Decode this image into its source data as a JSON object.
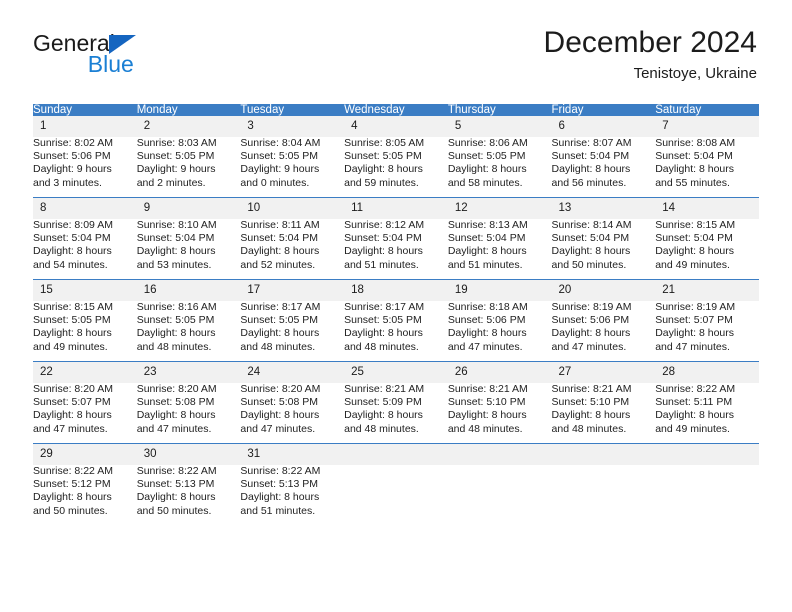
{
  "brand": {
    "name_top": "General",
    "name_bottom": "Blue",
    "triangle_color": "#1565c0",
    "blue_text_color": "#1a7fd4"
  },
  "header": {
    "title": "December 2024",
    "subtitle": "Tenistoye, Ukraine"
  },
  "theme": {
    "header_row_bg": "#3b7dc4",
    "header_row_text": "#ffffff",
    "daynum_bg": "#f1f1f1",
    "row_divider": "#3b7dc4"
  },
  "calendar": {
    "weekday_headers": [
      "Sunday",
      "Monday",
      "Tuesday",
      "Wednesday",
      "Thursday",
      "Friday",
      "Saturday"
    ],
    "weeks": [
      [
        {
          "day": "1",
          "sunrise": "Sunrise: 8:02 AM",
          "sunset": "Sunset: 5:06 PM",
          "daylight_1": "Daylight: 9 hours",
          "daylight_2": "and 3 minutes."
        },
        {
          "day": "2",
          "sunrise": "Sunrise: 8:03 AM",
          "sunset": "Sunset: 5:05 PM",
          "daylight_1": "Daylight: 9 hours",
          "daylight_2": "and 2 minutes."
        },
        {
          "day": "3",
          "sunrise": "Sunrise: 8:04 AM",
          "sunset": "Sunset: 5:05 PM",
          "daylight_1": "Daylight: 9 hours",
          "daylight_2": "and 0 minutes."
        },
        {
          "day": "4",
          "sunrise": "Sunrise: 8:05 AM",
          "sunset": "Sunset: 5:05 PM",
          "daylight_1": "Daylight: 8 hours",
          "daylight_2": "and 59 minutes."
        },
        {
          "day": "5",
          "sunrise": "Sunrise: 8:06 AM",
          "sunset": "Sunset: 5:05 PM",
          "daylight_1": "Daylight: 8 hours",
          "daylight_2": "and 58 minutes."
        },
        {
          "day": "6",
          "sunrise": "Sunrise: 8:07 AM",
          "sunset": "Sunset: 5:04 PM",
          "daylight_1": "Daylight: 8 hours",
          "daylight_2": "and 56 minutes."
        },
        {
          "day": "7",
          "sunrise": "Sunrise: 8:08 AM",
          "sunset": "Sunset: 5:04 PM",
          "daylight_1": "Daylight: 8 hours",
          "daylight_2": "and 55 minutes."
        }
      ],
      [
        {
          "day": "8",
          "sunrise": "Sunrise: 8:09 AM",
          "sunset": "Sunset: 5:04 PM",
          "daylight_1": "Daylight: 8 hours",
          "daylight_2": "and 54 minutes."
        },
        {
          "day": "9",
          "sunrise": "Sunrise: 8:10 AM",
          "sunset": "Sunset: 5:04 PM",
          "daylight_1": "Daylight: 8 hours",
          "daylight_2": "and 53 minutes."
        },
        {
          "day": "10",
          "sunrise": "Sunrise: 8:11 AM",
          "sunset": "Sunset: 5:04 PM",
          "daylight_1": "Daylight: 8 hours",
          "daylight_2": "and 52 minutes."
        },
        {
          "day": "11",
          "sunrise": "Sunrise: 8:12 AM",
          "sunset": "Sunset: 5:04 PM",
          "daylight_1": "Daylight: 8 hours",
          "daylight_2": "and 51 minutes."
        },
        {
          "day": "12",
          "sunrise": "Sunrise: 8:13 AM",
          "sunset": "Sunset: 5:04 PM",
          "daylight_1": "Daylight: 8 hours",
          "daylight_2": "and 51 minutes."
        },
        {
          "day": "13",
          "sunrise": "Sunrise: 8:14 AM",
          "sunset": "Sunset: 5:04 PM",
          "daylight_1": "Daylight: 8 hours",
          "daylight_2": "and 50 minutes."
        },
        {
          "day": "14",
          "sunrise": "Sunrise: 8:15 AM",
          "sunset": "Sunset: 5:04 PM",
          "daylight_1": "Daylight: 8 hours",
          "daylight_2": "and 49 minutes."
        }
      ],
      [
        {
          "day": "15",
          "sunrise": "Sunrise: 8:15 AM",
          "sunset": "Sunset: 5:05 PM",
          "daylight_1": "Daylight: 8 hours",
          "daylight_2": "and 49 minutes."
        },
        {
          "day": "16",
          "sunrise": "Sunrise: 8:16 AM",
          "sunset": "Sunset: 5:05 PM",
          "daylight_1": "Daylight: 8 hours",
          "daylight_2": "and 48 minutes."
        },
        {
          "day": "17",
          "sunrise": "Sunrise: 8:17 AM",
          "sunset": "Sunset: 5:05 PM",
          "daylight_1": "Daylight: 8 hours",
          "daylight_2": "and 48 minutes."
        },
        {
          "day": "18",
          "sunrise": "Sunrise: 8:17 AM",
          "sunset": "Sunset: 5:05 PM",
          "daylight_1": "Daylight: 8 hours",
          "daylight_2": "and 48 minutes."
        },
        {
          "day": "19",
          "sunrise": "Sunrise: 8:18 AM",
          "sunset": "Sunset: 5:06 PM",
          "daylight_1": "Daylight: 8 hours",
          "daylight_2": "and 47 minutes."
        },
        {
          "day": "20",
          "sunrise": "Sunrise: 8:19 AM",
          "sunset": "Sunset: 5:06 PM",
          "daylight_1": "Daylight: 8 hours",
          "daylight_2": "and 47 minutes."
        },
        {
          "day": "21",
          "sunrise": "Sunrise: 8:19 AM",
          "sunset": "Sunset: 5:07 PM",
          "daylight_1": "Daylight: 8 hours",
          "daylight_2": "and 47 minutes."
        }
      ],
      [
        {
          "day": "22",
          "sunrise": "Sunrise: 8:20 AM",
          "sunset": "Sunset: 5:07 PM",
          "daylight_1": "Daylight: 8 hours",
          "daylight_2": "and 47 minutes."
        },
        {
          "day": "23",
          "sunrise": "Sunrise: 8:20 AM",
          "sunset": "Sunset: 5:08 PM",
          "daylight_1": "Daylight: 8 hours",
          "daylight_2": "and 47 minutes."
        },
        {
          "day": "24",
          "sunrise": "Sunrise: 8:20 AM",
          "sunset": "Sunset: 5:08 PM",
          "daylight_1": "Daylight: 8 hours",
          "daylight_2": "and 47 minutes."
        },
        {
          "day": "25",
          "sunrise": "Sunrise: 8:21 AM",
          "sunset": "Sunset: 5:09 PM",
          "daylight_1": "Daylight: 8 hours",
          "daylight_2": "and 48 minutes."
        },
        {
          "day": "26",
          "sunrise": "Sunrise: 8:21 AM",
          "sunset": "Sunset: 5:10 PM",
          "daylight_1": "Daylight: 8 hours",
          "daylight_2": "and 48 minutes."
        },
        {
          "day": "27",
          "sunrise": "Sunrise: 8:21 AM",
          "sunset": "Sunset: 5:10 PM",
          "daylight_1": "Daylight: 8 hours",
          "daylight_2": "and 48 minutes."
        },
        {
          "day": "28",
          "sunrise": "Sunrise: 8:22 AM",
          "sunset": "Sunset: 5:11 PM",
          "daylight_1": "Daylight: 8 hours",
          "daylight_2": "and 49 minutes."
        }
      ],
      [
        {
          "day": "29",
          "sunrise": "Sunrise: 8:22 AM",
          "sunset": "Sunset: 5:12 PM",
          "daylight_1": "Daylight: 8 hours",
          "daylight_2": "and 50 minutes."
        },
        {
          "day": "30",
          "sunrise": "Sunrise: 8:22 AM",
          "sunset": "Sunset: 5:13 PM",
          "daylight_1": "Daylight: 8 hours",
          "daylight_2": "and 50 minutes."
        },
        {
          "day": "31",
          "sunrise": "Sunrise: 8:22 AM",
          "sunset": "Sunset: 5:13 PM",
          "daylight_1": "Daylight: 8 hours",
          "daylight_2": "and 51 minutes."
        },
        {
          "day": "",
          "sunrise": "",
          "sunset": "",
          "daylight_1": "",
          "daylight_2": ""
        },
        {
          "day": "",
          "sunrise": "",
          "sunset": "",
          "daylight_1": "",
          "daylight_2": ""
        },
        {
          "day": "",
          "sunrise": "",
          "sunset": "",
          "daylight_1": "",
          "daylight_2": ""
        },
        {
          "day": "",
          "sunrise": "",
          "sunset": "",
          "daylight_1": "",
          "daylight_2": ""
        }
      ]
    ]
  }
}
